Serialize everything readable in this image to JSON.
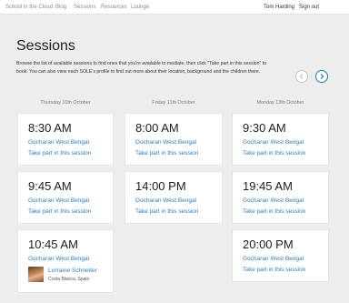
{
  "nav": {
    "items": [
      "School in the Cloud",
      "Blog",
      "Sessions",
      "Resources",
      "Lounge"
    ],
    "user": "Tom Harding",
    "signout": "Sign out"
  },
  "page": {
    "title": "Sessions",
    "intro": "Browse the list of available sessions to find ones that you're available to mediate, then click \"Take part in this session\" to book. You can also view each SOLE's profile to find out more about their location, background and the children there."
  },
  "pager": {
    "prev_icon": "chevron-left-icon",
    "next_icon": "chevron-right-icon",
    "accent": "#1a7ab8"
  },
  "days": [
    "Thursday 10th October",
    "Friday 11th October",
    "Monday 13th October"
  ],
  "sessions": [
    {
      "time": "8:30 AM",
      "location": "Gocharan West Bengal",
      "action": "Take part in this session"
    },
    {
      "time": "8:00 AM",
      "location": "Gocharan West Bengal",
      "action": "Take part in this session"
    },
    {
      "time": "9:30 AM",
      "location": "Gocharan West Bengal",
      "action": "Take part in this session"
    },
    {
      "time": "9:45 AM",
      "location": "Gocharan West Bengal",
      "action": "Take part in this session"
    },
    {
      "time": "14:00 PM",
      "location": "Gocharan West Bengal",
      "action": "Take part in this session"
    },
    {
      "time": "19:45 AM",
      "location": "Gocharan West Bengal",
      "action": "Take part in this session"
    },
    {
      "time": "10:45 AM",
      "location": "Gocharan West Bengal",
      "booked_by": {
        "name": "Lorraine Schneiter",
        "place": "Costa Blanca, Spain"
      }
    },
    {
      "time": "20:00 PM",
      "location": "Gocharan West Bengal",
      "action": "Take part in this session"
    }
  ],
  "colors": {
    "link": "#2c7dbc",
    "background": "#ededed",
    "card": "#ffffff"
  }
}
